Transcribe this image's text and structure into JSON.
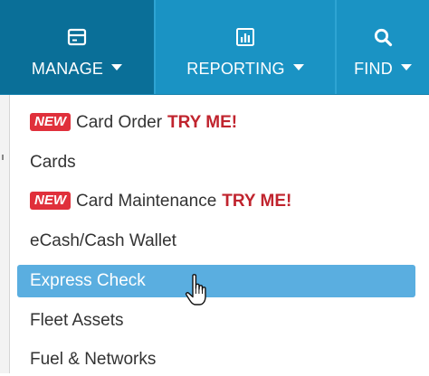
{
  "nav": {
    "manage": {
      "label": "MANAGE",
      "icon": "card-icon"
    },
    "reporting": {
      "label": "REPORTING",
      "icon": "bar-chart-icon"
    },
    "find": {
      "label": "FIND",
      "icon": "search-icon"
    }
  },
  "menu": {
    "items": [
      {
        "badge": "NEW",
        "label": "Card Order",
        "cta": "TRY ME!"
      },
      {
        "label": "Cards"
      },
      {
        "badge": "NEW",
        "label": "Card Maintenance",
        "cta": "TRY ME!"
      },
      {
        "label": "eCash/Cash Wallet"
      },
      {
        "label": "Express Check",
        "state": "highlighted"
      },
      {
        "label": "Fleet Assets"
      },
      {
        "label": "Fuel & Networks"
      }
    ]
  },
  "colors": {
    "nav_bg": "#1a93c4",
    "nav_active_bg": "#0a6f98",
    "highlight_bg": "#5aaee0",
    "badge_bg": "#e0303b",
    "cta_text": "#c0242e"
  },
  "cursor": {
    "icon": "hand-pointer-icon"
  }
}
